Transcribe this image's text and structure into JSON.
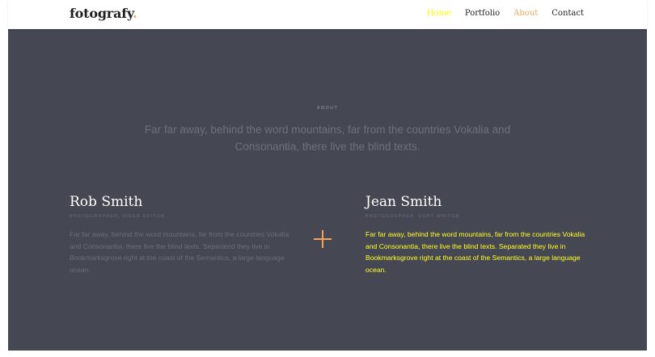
{
  "header": {
    "logo": "fotografy",
    "logo_dot": ".",
    "nav": [
      {
        "label": "Home",
        "color": "#ffff00"
      },
      {
        "label": "Portfolio",
        "color": "#222222"
      },
      {
        "label": "About",
        "color": "#f0a55f"
      },
      {
        "label": "Contact",
        "color": "#222222"
      }
    ]
  },
  "about": {
    "label": "ABOUT",
    "intro": "Far far away, behind the word mountains, far from the countries Vokalia and Consonantia, there live the blind texts."
  },
  "people": [
    {
      "name": "Rob Smith",
      "role": "PHOTOGRAPHER, VIDEO EDITOR",
      "bio": "Far far away, behind the word mountains, far from the countries Vokalia and Consonantia, there live the blind texts. Separated they live in Bookmarksgrove right at the coast of the Semantics, a large language ocean."
    },
    {
      "name": "Jean Smith",
      "role": "PHOTOGRAPHER, COPY WRITER",
      "bio": "Far far away, behind the word mountains, far from the countries Vokalia and Consonantia, there live the blind texts. Separated they live in Bookmarksgrove right at the coast of the Semantics, a large language ocean."
    }
  ],
  "colors": {
    "hero_background": "#454852",
    "accent": "#f0a55f",
    "highlight": "#ffff2a"
  },
  "icons": {
    "plus": "plus-icon"
  }
}
